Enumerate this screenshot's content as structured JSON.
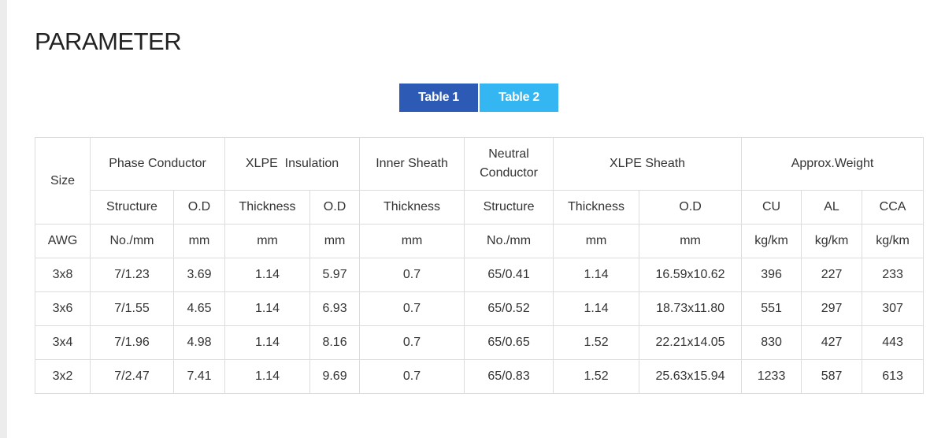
{
  "title": "PARAMETER",
  "tabs": [
    {
      "label": "Table 1",
      "active": true,
      "color": "#2c5ab5"
    },
    {
      "label": "Table 2",
      "active": false,
      "color": "#33b6f2"
    }
  ],
  "table": {
    "size_header": "Size",
    "groups": {
      "phase_conductor": "Phase Conductor",
      "xlpe_insulation": "XLPE  Insulation",
      "inner_sheath": "Inner Sheath",
      "neutral_line1": "Neutral",
      "neutral_line2": "Conductor",
      "xlpe_sheath": "XLPE Sheath",
      "approx_weight": "Approx.Weight"
    },
    "subheaders": {
      "pc_structure": "Structure",
      "pc_od": "O.D",
      "ins_thickness": "Thickness",
      "ins_od": "O.D",
      "is_thickness": "Thickness",
      "nc_structure": "Structure",
      "sh_thickness": "Thickness",
      "sh_od": "O.D",
      "w_cu": "CU",
      "w_al": "AL",
      "w_cca": "CCA"
    },
    "units": [
      "AWG",
      "No./mm",
      "mm",
      "mm",
      "mm",
      "mm",
      "No./mm",
      "mm",
      "mm",
      "kg/km",
      "kg/km",
      "kg/km"
    ],
    "rows": [
      [
        "3x8",
        "7/1.23",
        "3.69",
        "1.14",
        "5.97",
        "0.7",
        "65/0.41",
        "1.14",
        "16.59x10.62",
        "396",
        "227",
        "233"
      ],
      [
        "3x6",
        "7/1.55",
        "4.65",
        "1.14",
        "6.93",
        "0.7",
        "65/0.52",
        "1.14",
        "18.73x11.80",
        "551",
        "297",
        "307"
      ],
      [
        "3x4",
        "7/1.96",
        "4.98",
        "1.14",
        "8.16",
        "0.7",
        "65/0.65",
        "1.52",
        "22.21x14.05",
        "830",
        "427",
        "443"
      ],
      [
        "3x2",
        "7/2.47",
        "7.41",
        "1.14",
        "9.69",
        "0.7",
        "65/0.83",
        "1.52",
        "25.63x15.94",
        "1233",
        "587",
        "613"
      ]
    ]
  }
}
